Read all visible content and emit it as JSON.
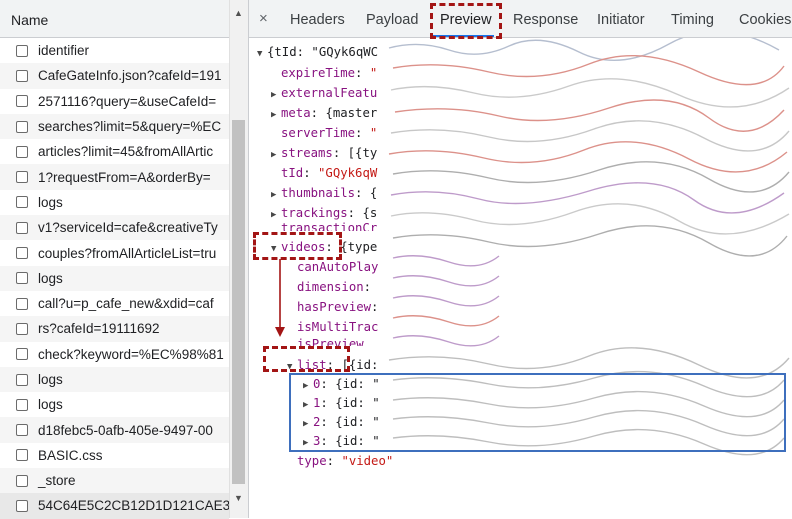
{
  "requests_panel": {
    "header": "Name",
    "rows": [
      "identifier",
      "CafeGateInfo.json?cafeId=191",
      "2571116?query=&useCafeId=",
      "searches?limit=5&query=%EC",
      "articles?limit=45&fromAllArtic",
      "1?requestFrom=A&orderBy=",
      "logs",
      "v1?serviceId=cafe&creativeTy",
      "couples?fromAllArticleList=tru",
      "logs",
      "call?u=p_cafe_new&xdid=caf",
      "rs?cafeId=19111692",
      "check?keyword=%EC%98%81",
      "logs",
      "logs",
      "d18febc5-0afb-405e-9497-00",
      "BASIC.css",
      "_store",
      "54C64E5C2CB12D1D121CAE3"
    ]
  },
  "tabs": {
    "close": "×",
    "items": [
      "Headers",
      "Payload",
      "Preview",
      "Response",
      "Initiator",
      "Timing",
      "Cookies"
    ],
    "active": "Preview"
  },
  "preview": {
    "root": "{tId: \"GQyk6qWC",
    "expireTime": {
      "key": "expireTime",
      "val": "\""
    },
    "externalFeatures": {
      "key": "externalFeatu"
    },
    "meta": {
      "key": "meta",
      "val": "{master"
    },
    "serverTime": {
      "key": "serverTime",
      "val": "\""
    },
    "streams": {
      "key": "streams",
      "val": "[{ty"
    },
    "tId": {
      "key": "tId",
      "val": "\"GQyk6qW"
    },
    "thumbnails": {
      "key": "thumbnails",
      "val": "{"
    },
    "trackings": {
      "key": "trackings",
      "val": "{s"
    },
    "transactionCr": {
      "key": "transactionCr"
    },
    "videos": {
      "key": "videos",
      "val": "{type"
    },
    "canAutoPlay": {
      "key": "canAutoPlay"
    },
    "dimension": {
      "key": "dimension"
    },
    "hasPreview": {
      "key": "hasPreview"
    },
    "isMultiTrac": {
      "key": "isMultiTrac"
    },
    "isPreview": {
      "key": "isPreview"
    },
    "list": {
      "key": "list",
      "val": "[{id:"
    },
    "list_items": [
      {
        "index": "0",
        "val": "{id: \""
      },
      {
        "index": "1",
        "val": "{id: \""
      },
      {
        "index": "2",
        "val": "{id: \""
      },
      {
        "index": "3",
        "val": "{id: \""
      }
    ],
    "type": {
      "key": "type",
      "val": "\"video\""
    }
  },
  "colors": {
    "key": "#881280",
    "string": "#c41a16",
    "annotation_red": "#a31515",
    "annotation_blue": "#3e6fbd",
    "tab_active": "#1a73e8"
  }
}
